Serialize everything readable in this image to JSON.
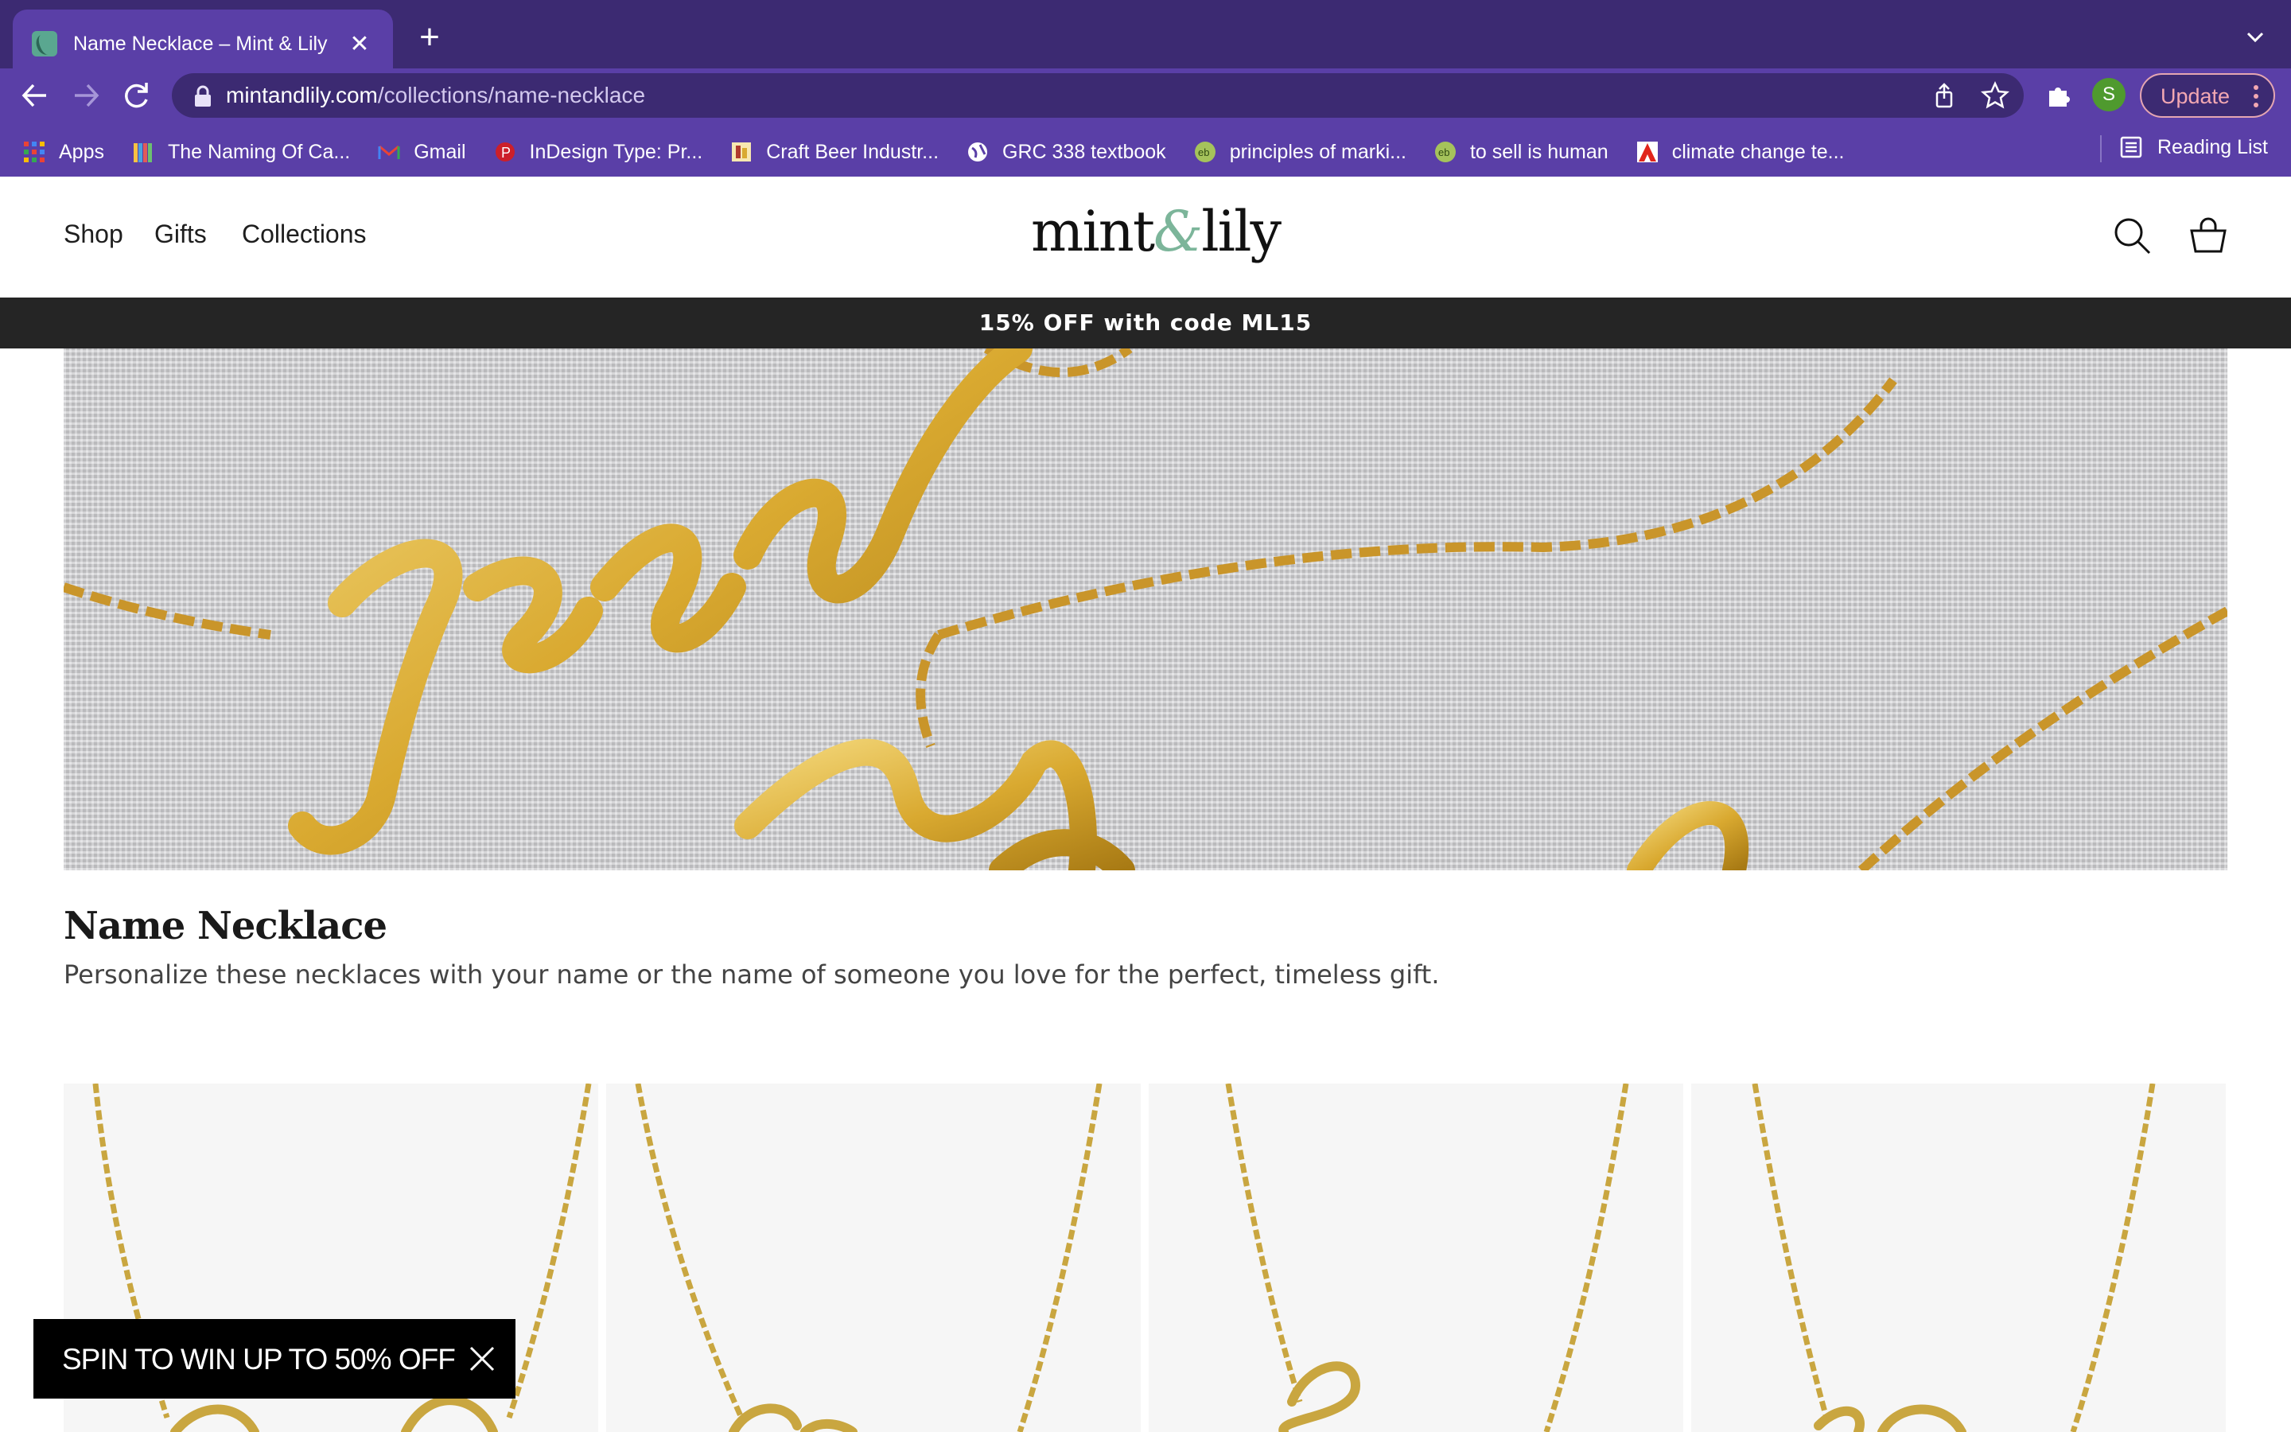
{
  "browser": {
    "tab": {
      "title": "Name Necklace – Mint & Lily",
      "close": "✕"
    },
    "new_tab": "+",
    "url": {
      "domain": "mintandlily.com",
      "path": "/collections/name-necklace"
    },
    "profile_initial": "S",
    "update_label": "Update",
    "bookmarks": [
      {
        "label": "Apps",
        "icon": "apps-grid-icon"
      },
      {
        "label": "The Naming Of Ca...",
        "icon": "books-icon"
      },
      {
        "label": "Gmail",
        "icon": "gmail-icon"
      },
      {
        "label": "InDesign Type: Pr...",
        "icon": "pinterest-icon"
      },
      {
        "label": "Craft Beer Industr...",
        "icon": "ibisworld-icon"
      },
      {
        "label": "GRC 338 textbook",
        "icon": "globe-icon"
      },
      {
        "label": "principles of marki...",
        "icon": "eb-icon"
      },
      {
        "label": "to sell is human",
        "icon": "eb-icon"
      },
      {
        "label": "climate change te...",
        "icon": "adobe-icon"
      }
    ],
    "reading_list": "Reading List"
  },
  "site": {
    "nav": [
      "Shop",
      "Gifts",
      "Collections"
    ],
    "logo": {
      "left": "mint",
      "amp": "&",
      "right": "lily"
    },
    "promo": "15% OFF with code ML15",
    "title": "Name Necklace",
    "description": "Personalize these necklaces with your name or the name of someone you love for the perfect, timeless gift.",
    "spin_banner": "SPIN TO WIN UP TO 50% OFF"
  },
  "colors": {
    "tabstrip": "#3c2a72",
    "toolbar": "#5a3fa7",
    "promo_bar": "#252525",
    "gold": "#d9a930",
    "logo_accent": "#7cb59a"
  }
}
